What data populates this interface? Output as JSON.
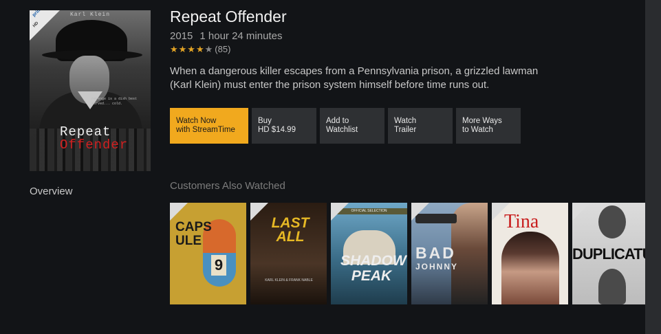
{
  "movie": {
    "title": "Repeat Offender",
    "year": "2015",
    "duration": "1 hour 24 minutes",
    "rating_stars": "★★★★",
    "rating_empty": "★",
    "rating_value": 4,
    "rating_count": "(85)",
    "description": "When a dangerous killer escapes from a Pennsylvania prison, a grizzled lawman (Karl Klein) must enter the prison system himself before time runs out."
  },
  "poster": {
    "actor": "Karl Klein",
    "tagline": "revenge is a dish best served... cold.",
    "title_line1": "Repeat",
    "title_line2": "Offender",
    "badge_hd": "HD",
    "badge_prime": "prime"
  },
  "side_nav": {
    "overview": "Overview"
  },
  "actions": {
    "watch_now": "Watch Now\nwith StreamTime",
    "buy": "Buy\nHD $14.99",
    "watchlist": "Add to\nWatchlist",
    "trailer": "Watch\nTrailer",
    "more_ways": "More Ways\nto Watch"
  },
  "customers_also_watched": {
    "title": "Customers Also Watched",
    "items": [
      {
        "title": "CAPS ULE",
        "extra": "9"
      },
      {
        "title": "LAST ALL",
        "extra": "KARL KLEIN & FRANK NABLE"
      },
      {
        "title": "SHADOW PEAK",
        "extra": "OFFICIAL SELECTION"
      },
      {
        "title": "BAD",
        "extra": "JOHNNY"
      },
      {
        "title": "Tina",
        "extra": ""
      },
      {
        "title": "DUPLICATUM",
        "extra": ""
      }
    ]
  },
  "colors": {
    "background": "#121417",
    "accent": "#f1a91e",
    "button": "#2e3033",
    "star": "#e3a425"
  }
}
